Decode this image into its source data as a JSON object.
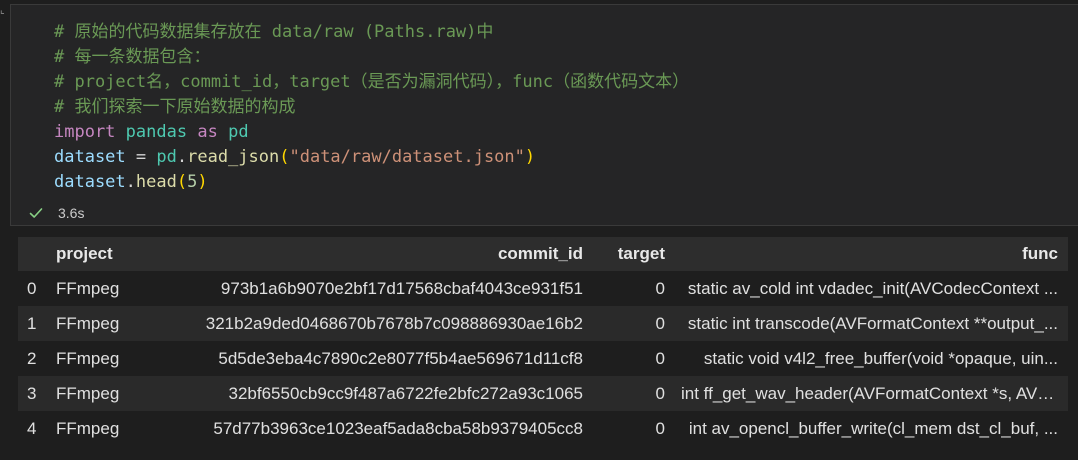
{
  "cell": {
    "code_lines": [
      [
        {
          "t": "comment",
          "v": "# 原始的代码数据集存放在 data/raw (Paths.raw)中"
        }
      ],
      [
        {
          "t": "comment",
          "v": "# 每一条数据包含："
        }
      ],
      [
        {
          "t": "comment",
          "v": "# project名，commit_id，target（是否为漏洞代码），func（函数代码文本）"
        }
      ],
      [
        {
          "t": "comment",
          "v": "# 我们探索一下原始数据的构成"
        }
      ],
      [
        {
          "t": "keyword",
          "v": "import"
        },
        {
          "t": "punct",
          "v": " "
        },
        {
          "t": "module",
          "v": "pandas"
        },
        {
          "t": "punct",
          "v": " "
        },
        {
          "t": "keyword",
          "v": "as"
        },
        {
          "t": "punct",
          "v": " "
        },
        {
          "t": "module",
          "v": "pd"
        }
      ],
      [
        {
          "t": "variable",
          "v": "dataset"
        },
        {
          "t": "punct",
          "v": " = "
        },
        {
          "t": "module",
          "v": "pd"
        },
        {
          "t": "punct",
          "v": "."
        },
        {
          "t": "func",
          "v": "read_json"
        },
        {
          "t": "paren",
          "v": "("
        },
        {
          "t": "string",
          "v": "\"data/raw/dataset.json\""
        },
        {
          "t": "paren",
          "v": ")"
        }
      ],
      [
        {
          "t": "variable",
          "v": "dataset"
        },
        {
          "t": "punct",
          "v": "."
        },
        {
          "t": "func",
          "v": "head"
        },
        {
          "t": "paren",
          "v": "("
        },
        {
          "t": "number",
          "v": "5"
        },
        {
          "t": "paren",
          "v": ")"
        }
      ]
    ],
    "status": {
      "icon": "check-icon",
      "exec_time": "3.6s",
      "success_color": "#89d185"
    }
  },
  "output": {
    "columns": [
      "",
      "project",
      "commit_id",
      "target",
      "func"
    ],
    "rows": [
      [
        "0",
        "FFmpeg",
        "973b1a6b9070e2bf17d17568cbaf4043ce931f51",
        "0",
        "static av_cold int vdadec_init(AVCodecContext ..."
      ],
      [
        "1",
        "FFmpeg",
        "321b2a9ded0468670b7678b7c098886930ae16b2",
        "0",
        "static int transcode(AVFormatContext **output_..."
      ],
      [
        "2",
        "FFmpeg",
        "5d5de3eba4c7890c2e8077f5b4ae569671d11cf8",
        "0",
        "static void v4l2_free_buffer(void *opaque, uin..."
      ],
      [
        "3",
        "FFmpeg",
        "32bf6550cb9cc9f487a6722fe2bfc272a93c1065",
        "0",
        "int ff_get_wav_header(AVFormatContext *s, AVIO..."
      ],
      [
        "4",
        "FFmpeg",
        "57d77b3963ce1023eaf5ada8cba58b9379405cc8",
        "0",
        "int av_opencl_buffer_write(cl_mem dst_cl_buf, ..."
      ]
    ]
  }
}
